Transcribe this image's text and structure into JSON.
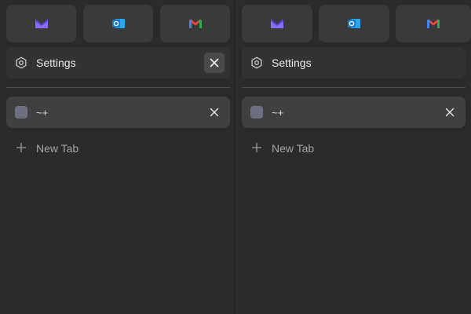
{
  "colors": {
    "background": "#2b2b2b",
    "pinned_tile": "#3a3a3a",
    "tab_settings": "#333333",
    "tab_active": "#404040",
    "close_hover": "#4a4a4a",
    "proton_mail": "#6d4aff",
    "outlook": "#0f78d4",
    "gmail_red": "#ea4335"
  },
  "panels": [
    {
      "pinned_tabs": [
        {
          "icon": "proton-mail-icon"
        },
        {
          "icon": "outlook-icon"
        },
        {
          "icon": "gmail-icon"
        }
      ],
      "settings_tab": {
        "icon": "gear-icon",
        "label": "Settings",
        "close_icon": "close-icon"
      },
      "active_tab": {
        "icon": "blank-favicon",
        "label": "~+",
        "close_icon": "close-icon"
      },
      "new_tab": {
        "icon": "plus-icon",
        "label": "New Tab"
      }
    },
    {
      "pinned_tabs": [
        {
          "icon": "proton-mail-icon"
        },
        {
          "icon": "outlook-icon"
        },
        {
          "icon": "gmail-icon"
        }
      ],
      "settings_tab": {
        "icon": "gear-icon",
        "label": "Settings",
        "close_icon": "close-icon"
      },
      "active_tab": {
        "icon": "blank-favicon",
        "label": "~+",
        "close_icon": "close-icon"
      },
      "new_tab": {
        "icon": "plus-icon",
        "label": "New Tab"
      }
    }
  ]
}
